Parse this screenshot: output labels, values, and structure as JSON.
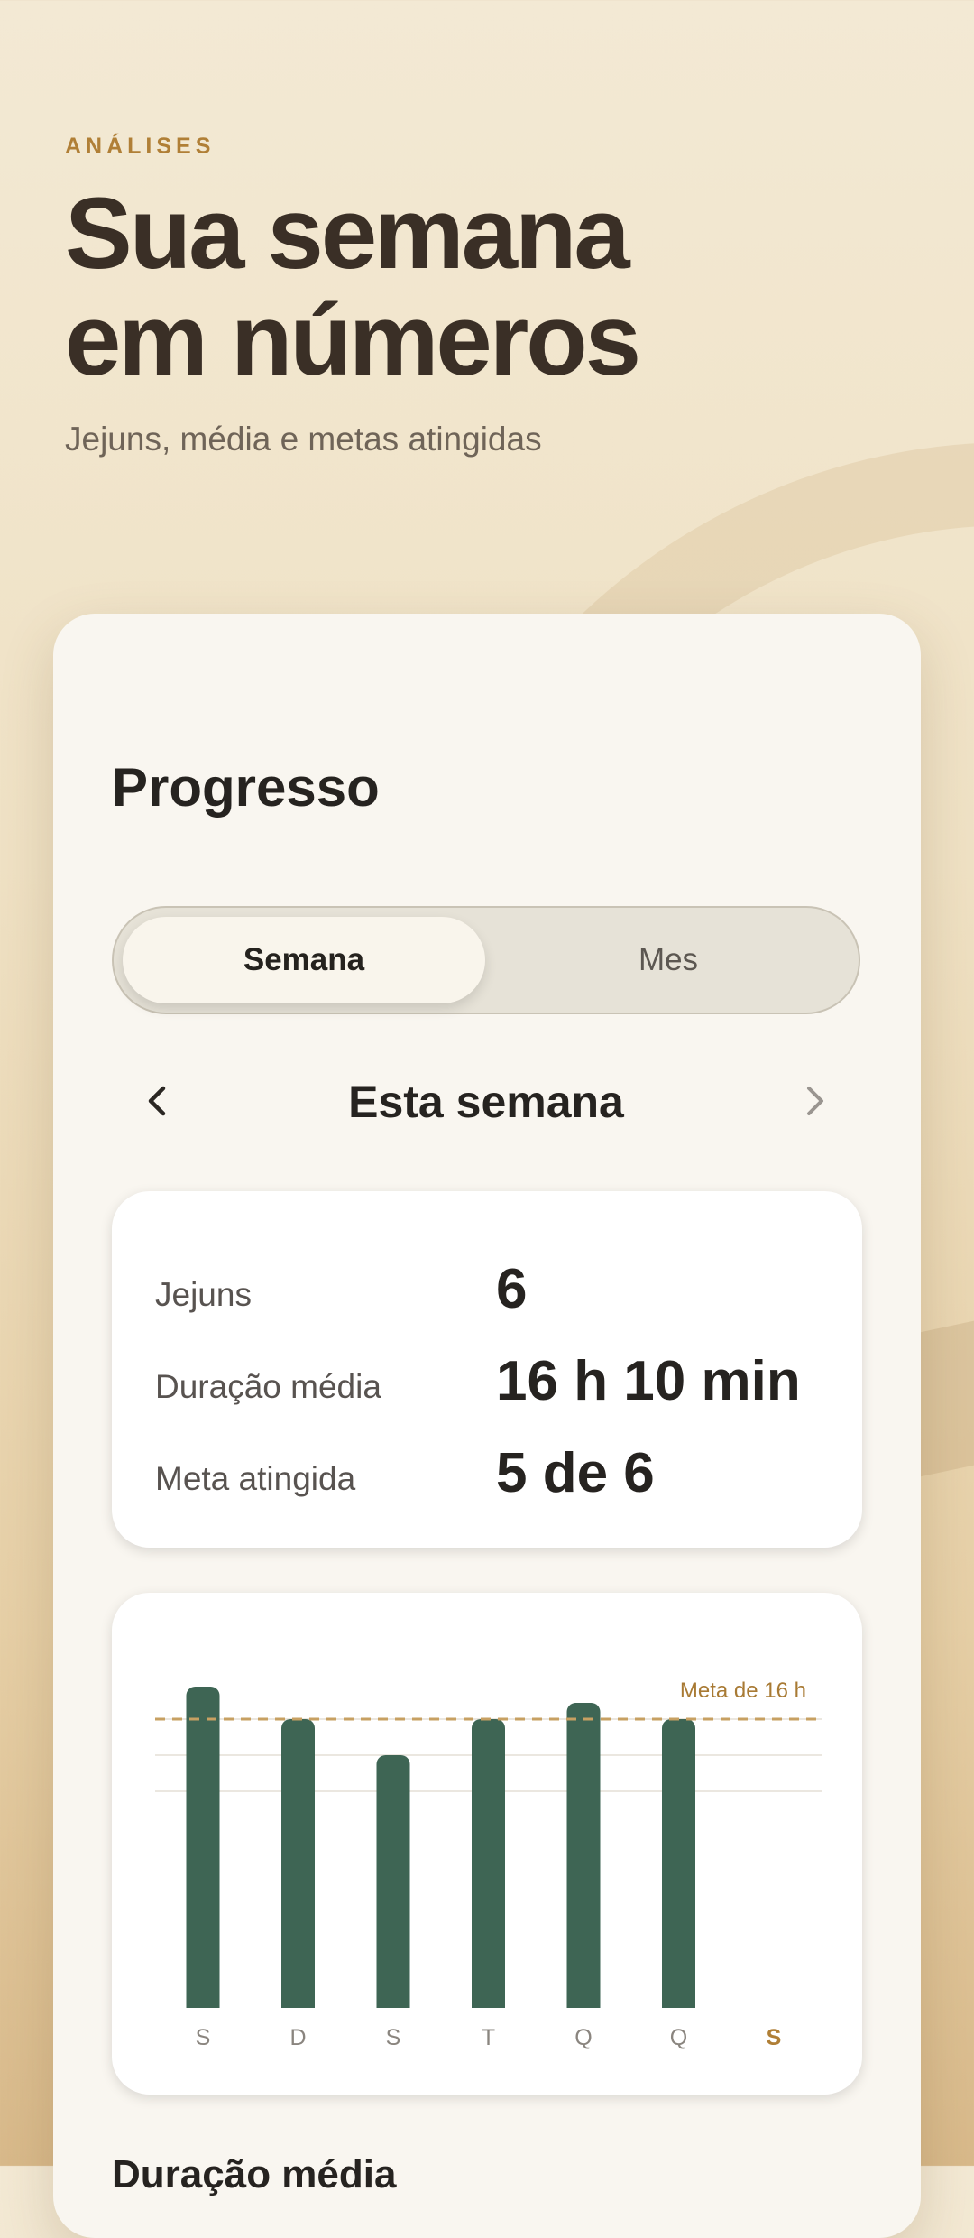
{
  "header": {
    "eyebrow": "ANÁLISES",
    "title_line1": "Sua semana",
    "title_line2": "em números",
    "subtitle": "Jejuns, média e metas atingidas"
  },
  "card": {
    "title": "Progresso",
    "tabs": [
      {
        "label": "Semana",
        "selected": true
      },
      {
        "label": "Mes",
        "selected": false
      }
    ],
    "period": {
      "label": "Esta semana",
      "prev_icon": "chevron-left-icon",
      "next_icon": "chevron-right-icon"
    },
    "stats": [
      {
        "label": "Jejuns",
        "value": "6"
      },
      {
        "label": "Duração média",
        "value": "16 h 10 min"
      },
      {
        "label": "Meta atingida",
        "value": "5 de 6"
      }
    ],
    "next_section_title": "Duração média"
  },
  "chart_data": {
    "type": "bar",
    "categories": [
      "S",
      "D",
      "S",
      "T",
      "Q",
      "Q",
      "S"
    ],
    "values": [
      17.8,
      16.0,
      14.0,
      16.0,
      16.9,
      16.0,
      null
    ],
    "goal": {
      "value": 16,
      "label": "Meta de 16 h"
    },
    "ylim": [
      0,
      18
    ],
    "highlight_category_index": 6,
    "colors": {
      "bar": "#3e6554",
      "goal": "#c7a062",
      "today": "#b07f36",
      "label": "#8a857f",
      "grid": "#ebe7e0"
    }
  }
}
